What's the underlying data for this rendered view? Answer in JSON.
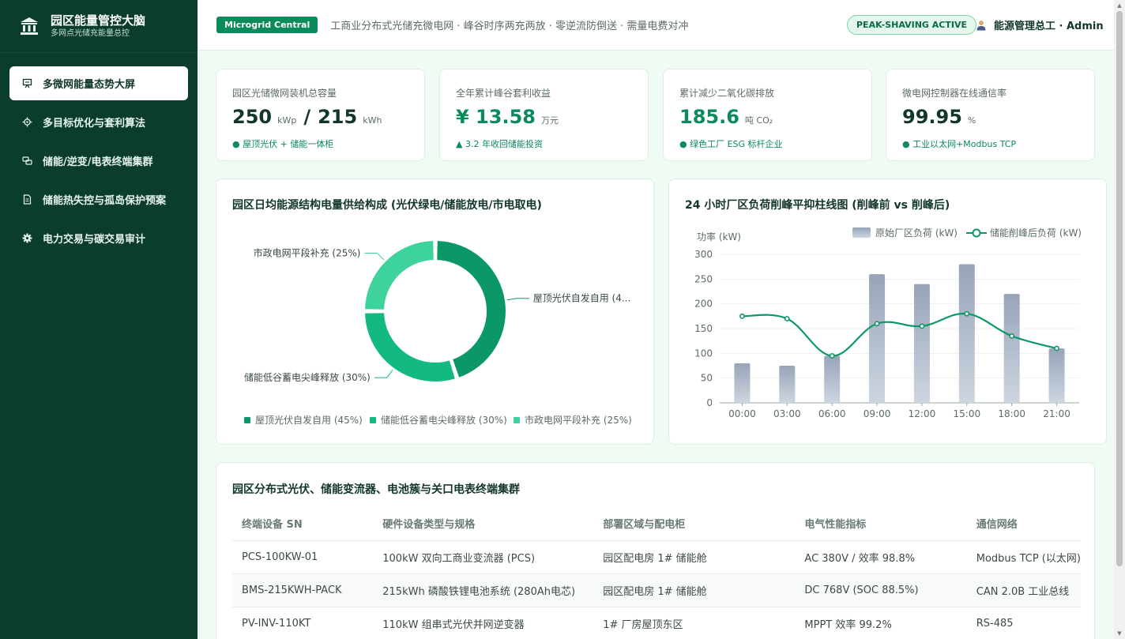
{
  "brand": {
    "title": "园区能量管控大脑",
    "subtitle": "多网点光储充能量总控"
  },
  "nav": [
    {
      "label": "多微网能量态势大屏",
      "icon": "presentation-icon",
      "active": true
    },
    {
      "label": "多目标优化与套利算法",
      "icon": "gear-outline-icon",
      "active": false
    },
    {
      "label": "储能/逆变/电表终端集群",
      "icon": "cluster-icon",
      "active": false
    },
    {
      "label": "储能热失控与孤岛保护预案",
      "icon": "document-icon",
      "active": false
    },
    {
      "label": "电力交易与碳交易审计",
      "icon": "cog-icon",
      "active": false
    }
  ],
  "header": {
    "chip": "Microgrid Central",
    "description": "工商业分布式光储充微电网 · 峰谷时序两充两放 · 零逆流防倒送 · 需量电费对冲",
    "status": "PEAK-SHAVING ACTIVE",
    "user": "能源管理总工 · Admin"
  },
  "kpis": [
    {
      "label": "园区光储微网装机总容量",
      "value1": "250",
      "unit1": "kWp",
      "sep": "/",
      "value2": "215",
      "unit2": "kWh",
      "sub": "● 屋顶光伏 + 储能一体柜",
      "color": "dark"
    },
    {
      "label": "全年累计峰谷套利收益",
      "value1": "¥ 13.58",
      "unit1": "万元",
      "sub": "▲ 3.2 年收回储能投资",
      "color": "green"
    },
    {
      "label": "累计减少二氧化碳排放",
      "value1": "185.6",
      "unit1": "吨 CO₂",
      "sub": "● 绿色工厂 ESG 标杆企业",
      "color": "green"
    },
    {
      "label": "微电网控制器在线通信率",
      "value1": "99.95",
      "unit1": "%",
      "sub": "● 工业以太网+Modbus TCP",
      "color": "dark"
    }
  ],
  "donut_card": {
    "title": "园区日均能源结构电量供给构成 (光伏绿电/储能放电/市电取电)"
  },
  "bar_card": {
    "title": "24 小时厂区负荷削峰平抑柱线图 (削峰前 vs 削峰后)"
  },
  "chart_data": [
    {
      "type": "pie",
      "categories": [
        "屋顶光伏自发自用",
        "储能低谷蓄电尖峰释放",
        "市政电网平段补充"
      ],
      "values": [
        45,
        30,
        25
      ],
      "slice_labels": [
        "屋顶光伏自发自用 (4...",
        "储能低谷蓄电尖峰释放 (30%)",
        "市政电网平段补充 (25%)"
      ],
      "legend": [
        "屋顶光伏自发自用 (45%)",
        "储能低谷蓄电尖峰释放 (30%)",
        "市政电网平段补充 (25%)"
      ],
      "colors": [
        "#0b9866",
        "#12b981",
        "#3dd39b"
      ],
      "legend_position": "bottom"
    },
    {
      "type": "bar",
      "categories": [
        "00:00",
        "03:00",
        "06:00",
        "09:00",
        "12:00",
        "15:00",
        "18:00",
        "21:00"
      ],
      "ylabel": "功率 (kW)",
      "ylim": [
        0,
        300
      ],
      "yticks": [
        0,
        50,
        100,
        150,
        200,
        250,
        300
      ],
      "series": [
        {
          "name": "原始厂区负荷 (kW)",
          "type": "bar",
          "values": [
            80,
            75,
            95,
            260,
            240,
            280,
            220,
            110
          ],
          "color": "#a4b0c2"
        },
        {
          "name": "储能削峰后负荷 (kW)",
          "type": "line",
          "values": [
            175,
            170,
            95,
            160,
            155,
            180,
            135,
            110
          ],
          "color": "#0b9866"
        }
      ],
      "legend_position": "top-right",
      "grid": true
    }
  ],
  "table": {
    "title": "园区分布式光伏、储能变流器、电池簇与关口电表终端集群",
    "columns": [
      "终端设备 SN",
      "硬件设备类型与规格",
      "部署区域与配电柜",
      "电气性能指标",
      "通信网络"
    ],
    "rows": [
      [
        "PCS-100KW-01",
        "100kW 双向工商业变流器 (PCS)",
        "园区配电房 1# 储能舱",
        "AC 380V / 效率 98.8%",
        "Modbus TCP (以太网)"
      ],
      [
        "BMS-215KWH-PACK",
        "215kWh 磷酸铁锂电池系统 (280Ah电芯)",
        "园区配电房 1# 储能舱",
        "DC 768V (SOC 88.5%)",
        "CAN 2.0B 工业总线"
      ],
      [
        "PV-INV-110KT",
        "110kW 组串式光伏并网逆变器",
        "1# 厂房屋顶东区",
        "MPPT 效率 99.2%",
        "RS-485"
      ]
    ]
  }
}
